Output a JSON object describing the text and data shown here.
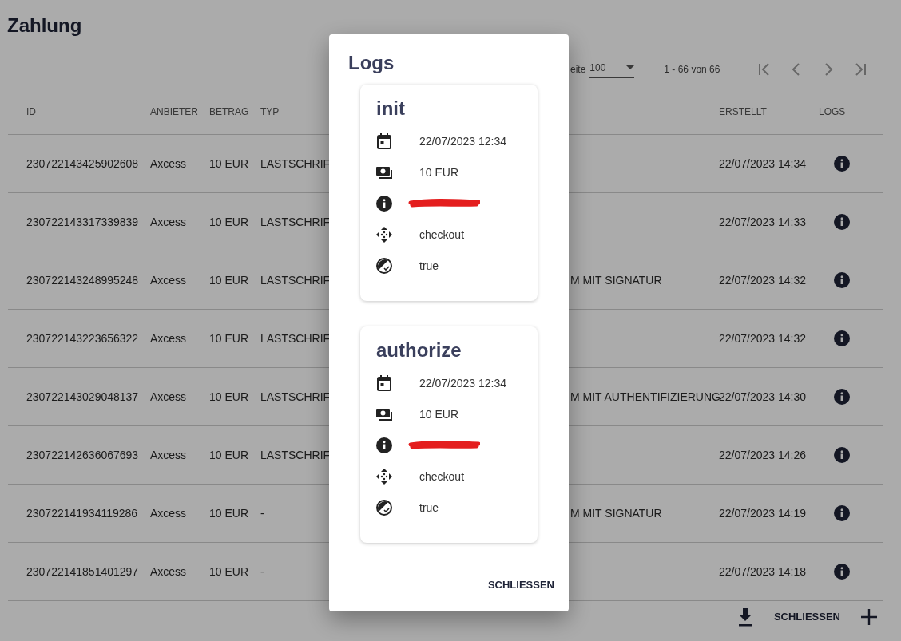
{
  "page": {
    "title": "Zahlung"
  },
  "paginator": {
    "items_label": "eite",
    "page_size": "100",
    "range": "1 - 66 von 66",
    "nav": [
      {
        "kind": "first",
        "disabled": true
      },
      {
        "kind": "prev",
        "disabled": true
      },
      {
        "kind": "next",
        "disabled": true
      },
      {
        "kind": "last",
        "disabled": true
      }
    ]
  },
  "table": {
    "columns": [
      "ID",
      "ANBIETER",
      "BETRAG",
      "TYP",
      "",
      "ERSTELLT",
      "LOGS"
    ],
    "rows": [
      {
        "id": "230722143425902608",
        "provider": "Axcess",
        "amount": "10 EUR",
        "type": "LASTSCHRIF",
        "column_5": "",
        "created": "22/07/2023 14:34"
      },
      {
        "id": "230722143317339839",
        "provider": "Axcess",
        "amount": "10 EUR",
        "type": "LASTSCHRIF",
        "column_5": "",
        "created": "22/07/2023 14:33"
      },
      {
        "id": "230722143248995248",
        "provider": "Axcess",
        "amount": "10 EUR",
        "type": "LASTSCHRIF",
        "column_5": "M MIT SIGNATUR",
        "created": "22/07/2023 14:32"
      },
      {
        "id": "230722143223656322",
        "provider": "Axcess",
        "amount": "10 EUR",
        "type": "LASTSCHRIF",
        "column_5": "",
        "created": "22/07/2023 14:32"
      },
      {
        "id": "230722143029048137",
        "provider": "Axcess",
        "amount": "10 EUR",
        "type": "LASTSCHRIF",
        "column_5": "M MIT AUTHENTIFIZIERUNG",
        "created": "22/07/2023 14:30"
      },
      {
        "id": "230722142636067693",
        "provider": "Axcess",
        "amount": "10 EUR",
        "type": "LASTSCHRIF",
        "column_5": "",
        "created": "22/07/2023 14:26"
      },
      {
        "id": "230722141934119286",
        "provider": "Axcess",
        "amount": "10 EUR",
        "type": "-",
        "column_5": "M MIT SIGNATUR",
        "created": "22/07/2023 14:19"
      },
      {
        "id": "230722141851401297",
        "provider": "Axcess",
        "amount": "10 EUR",
        "type": "-",
        "column_5": "",
        "created": "22/07/2023 14:18"
      }
    ]
  },
  "footer": {
    "button": "SCHLIESSEN"
  },
  "dialog": {
    "title": "Logs",
    "button": "SCHLIESSEN",
    "logs": [
      {
        "title": "init",
        "entries": [
          {
            "kind": "date",
            "text": "22/07/2023 12:34"
          },
          {
            "kind": "amount",
            "text": "10 EUR"
          },
          {
            "kind": "info",
            "redacted": true
          },
          {
            "kind": "flow",
            "text": "checkout"
          },
          {
            "kind": "flag",
            "text": "true"
          }
        ]
      },
      {
        "title": "authorize",
        "entries": [
          {
            "kind": "date",
            "text": "22/07/2023 12:34"
          },
          {
            "kind": "amount",
            "text": "10 EUR"
          },
          {
            "kind": "info",
            "redacted": true
          },
          {
            "kind": "flow",
            "text": "checkout"
          },
          {
            "kind": "flag",
            "text": "true"
          }
        ]
      }
    ]
  }
}
